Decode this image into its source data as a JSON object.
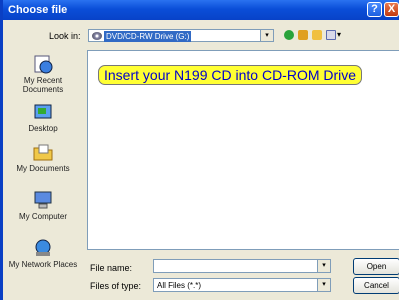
{
  "window": {
    "title": "Choose file"
  },
  "titlebar": {
    "help_label": "?",
    "close_label": "X"
  },
  "lookin": {
    "label": "Look in:",
    "value": "DVD/CD-RW Drive (G:)",
    "dropdown_glyph": "▾"
  },
  "toolbar": {
    "views_glyph": "▾"
  },
  "places": [
    {
      "label": "My Recent Documents",
      "icon": "recent-documents-icon"
    },
    {
      "label": "Desktop",
      "icon": "desktop-icon"
    },
    {
      "label": "My Documents",
      "icon": "my-documents-icon"
    },
    {
      "label": "My Computer",
      "icon": "my-computer-icon"
    },
    {
      "label": "My Network Places",
      "icon": "network-places-icon"
    }
  ],
  "banner": {
    "text": "Insert your N199 CD into CD-ROM Drive"
  },
  "filename": {
    "label": "File name:",
    "value": ""
  },
  "filetype": {
    "label": "Files of type:",
    "value": "All Files (*.*)",
    "dropdown_glyph": "▾"
  },
  "buttons": {
    "open": "Open",
    "cancel": "Cancel"
  },
  "colors": {
    "titlebar": "#0a4ed8",
    "banner_bg": "#ffff33",
    "banner_text": "#0000cc"
  }
}
